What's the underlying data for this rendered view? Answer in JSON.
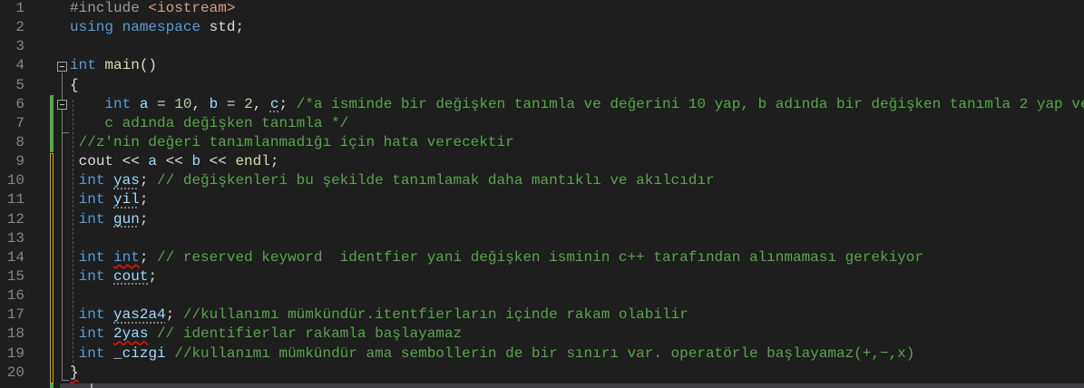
{
  "editor": {
    "line_numbers": [
      "1",
      "2",
      "3",
      "4",
      "5",
      "6",
      "7",
      "8",
      "9",
      "10",
      "11",
      "12",
      "13",
      "14",
      "15",
      "16",
      "17",
      "18",
      "19",
      "20"
    ],
    "colors": {
      "background": "#1e1e1e",
      "keyword": "#569cd6",
      "comment": "#57a64a",
      "change_saved": "#57a64a",
      "change_unsaved": "#c8a800"
    },
    "lines": [
      {
        "tokens": [
          {
            "text": "#include ",
            "c": "pp"
          },
          {
            "text": "<iostream>",
            "c": "str"
          }
        ]
      },
      {
        "tokens": [
          {
            "text": "using",
            "c": "kw"
          },
          {
            "text": " ",
            "c": "pl"
          },
          {
            "text": "namespace",
            "c": "kw"
          },
          {
            "text": " std;",
            "c": "pl"
          }
        ]
      },
      {
        "tokens": []
      },
      {
        "tokens": [
          {
            "text": "int",
            "c": "kw"
          },
          {
            "text": " ",
            "c": "pl"
          },
          {
            "text": "main",
            "c": "fn"
          },
          {
            "text": "()",
            "c": "pl"
          }
        ]
      },
      {
        "tokens": [
          {
            "text": "{",
            "c": "pl"
          }
        ]
      },
      {
        "tokens": [
          {
            "text": "    ",
            "c": "pl"
          },
          {
            "text": "int",
            "c": "kw"
          },
          {
            "text": " ",
            "c": "pl"
          },
          {
            "text": "a",
            "c": "id"
          },
          {
            "text": " = ",
            "c": "pl"
          },
          {
            "text": "10",
            "c": "num"
          },
          {
            "text": ", ",
            "c": "pl"
          },
          {
            "text": "b",
            "c": "id"
          },
          {
            "text": " = ",
            "c": "pl"
          },
          {
            "text": "2",
            "c": "num"
          },
          {
            "text": ", ",
            "c": "pl"
          },
          {
            "text": "c",
            "c": "id",
            "sq": "info"
          },
          {
            "text": "; ",
            "c": "pl"
          },
          {
            "text": "/*a isminde bir değişken tanımla ve değerini 10 yap, b adında bir değişken tanımla 2 yap ve ",
            "c": "cm"
          }
        ]
      },
      {
        "tokens": [
          {
            "text": "    c adında değişken tanımla */",
            "c": "cm"
          }
        ]
      },
      {
        "tokens": [
          {
            "text": " ",
            "c": "pl"
          },
          {
            "text": "//z'nin değeri tanımlanmadığı için hata verecektir",
            "c": "cm"
          }
        ]
      },
      {
        "tokens": [
          {
            "text": " ",
            "c": "pl"
          },
          {
            "text": "cout",
            "c": "pl"
          },
          {
            "text": " << ",
            "c": "pl"
          },
          {
            "text": "a",
            "c": "id"
          },
          {
            "text": " << ",
            "c": "pl"
          },
          {
            "text": "b",
            "c": "id"
          },
          {
            "text": " << ",
            "c": "pl"
          },
          {
            "text": "endl",
            "c": "fn"
          },
          {
            "text": ";",
            "c": "pl"
          }
        ]
      },
      {
        "tokens": [
          {
            "text": " ",
            "c": "pl"
          },
          {
            "text": "int",
            "c": "kw"
          },
          {
            "text": " ",
            "c": "pl"
          },
          {
            "text": "yas",
            "c": "id",
            "sq": "info"
          },
          {
            "text": "; ",
            "c": "pl"
          },
          {
            "text": "// değişkenleri bu şekilde tanımlamak daha mantıklı ve akılcıdır",
            "c": "cm"
          }
        ]
      },
      {
        "tokens": [
          {
            "text": " ",
            "c": "pl"
          },
          {
            "text": "int",
            "c": "kw"
          },
          {
            "text": " ",
            "c": "pl"
          },
          {
            "text": "yil",
            "c": "id",
            "sq": "info"
          },
          {
            "text": ";",
            "c": "pl"
          }
        ]
      },
      {
        "tokens": [
          {
            "text": " ",
            "c": "pl"
          },
          {
            "text": "int",
            "c": "kw"
          },
          {
            "text": " ",
            "c": "pl"
          },
          {
            "text": "gun",
            "c": "id",
            "sq": "info"
          },
          {
            "text": ";",
            "c": "pl"
          }
        ]
      },
      {
        "tokens": []
      },
      {
        "tokens": [
          {
            "text": " ",
            "c": "pl"
          },
          {
            "text": "int",
            "c": "kw"
          },
          {
            "text": " ",
            "c": "pl"
          },
          {
            "text": "int",
            "c": "kw",
            "sq": "err"
          },
          {
            "text": "; ",
            "c": "pl"
          },
          {
            "text": "// reserved keyword  identfier yani değişken isminin c++ tarafından alınmaması gerekiyor",
            "c": "cm"
          }
        ]
      },
      {
        "tokens": [
          {
            "text": " ",
            "c": "pl"
          },
          {
            "text": "int",
            "c": "kw"
          },
          {
            "text": " ",
            "c": "pl"
          },
          {
            "text": "cout",
            "c": "id",
            "sq": "info"
          },
          {
            "text": ";",
            "c": "pl"
          }
        ]
      },
      {
        "tokens": []
      },
      {
        "tokens": [
          {
            "text": " ",
            "c": "pl"
          },
          {
            "text": "int",
            "c": "kw"
          },
          {
            "text": " ",
            "c": "pl"
          },
          {
            "text": "yas2a4",
            "c": "id",
            "sq": "info"
          },
          {
            "text": "; ",
            "c": "pl"
          },
          {
            "text": "//kullanımı mümkündür.itentfierların içinde rakam olabilir",
            "c": "cm"
          }
        ]
      },
      {
        "tokens": [
          {
            "text": " ",
            "c": "pl"
          },
          {
            "text": "int",
            "c": "kw"
          },
          {
            "text": " ",
            "c": "pl"
          },
          {
            "text": "2yas",
            "c": "id",
            "sq": "err"
          },
          {
            "text": " ",
            "c": "pl"
          },
          {
            "text": "// identifierlar rakamla başlayamaz",
            "c": "cm"
          }
        ]
      },
      {
        "tokens": [
          {
            "text": " ",
            "c": "pl"
          },
          {
            "text": "int",
            "c": "kw"
          },
          {
            "text": " ",
            "c": "pl"
          },
          {
            "text": "_cizgi",
            "c": "id"
          },
          {
            "text": " ",
            "c": "pl"
          },
          {
            "text": "//kullanımı mümkündür ama sembollerin de bir sınırı var. operatörle başlayamaz(+,−,x)",
            "c": "cm"
          }
        ]
      },
      {
        "tokens": [
          {
            "text": "}",
            "c": "pl",
            "sq": "err"
          }
        ]
      }
    ]
  }
}
